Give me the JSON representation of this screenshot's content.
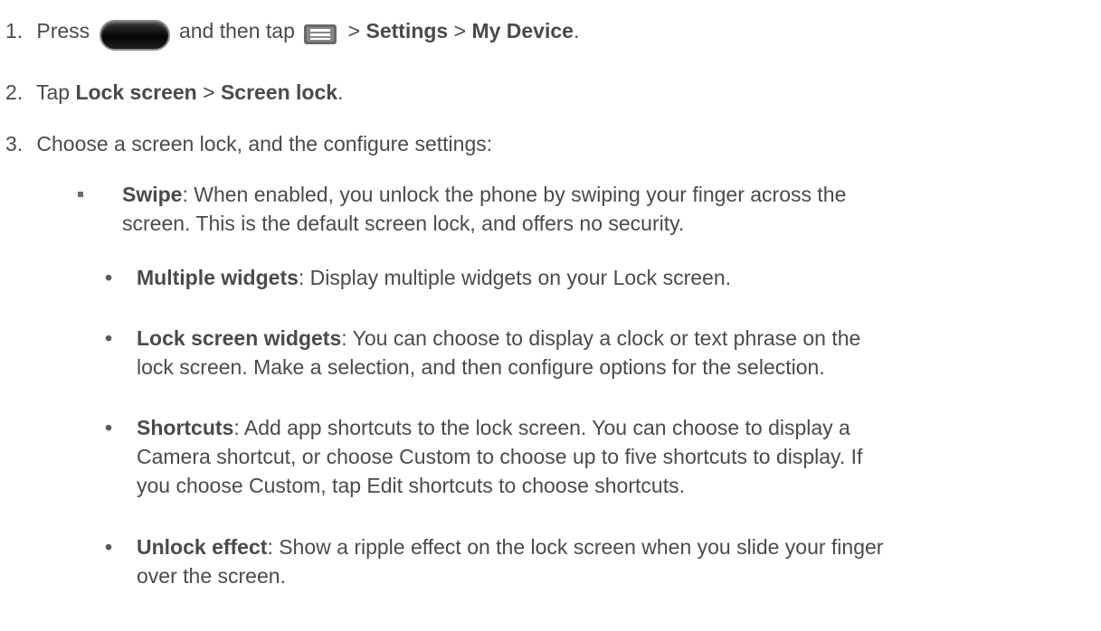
{
  "steps": [
    {
      "number": "1.",
      "t1": "Press",
      "t2": "and then tap",
      "t3": ">",
      "b1": "Settings",
      "t4": ">",
      "b2": "My Device",
      "t5": "."
    },
    {
      "number": "2.",
      "t1": "Tap",
      "b1": "Lock screen",
      "t2": ">",
      "b2": "Screen lock",
      "t3": "."
    },
    {
      "number": "3.",
      "text": "Choose a screen lock, and the configure settings:"
    }
  ],
  "swipe": {
    "term": "Swipe",
    "line1": ": When enabled, you unlock the phone by swiping your finger across the",
    "line2": "screen. This is the default screen lock, and offers no security."
  },
  "options": [
    {
      "term": "Multiple widgets",
      "lines": [
        ": Display multiple widgets on your Lock screen."
      ]
    },
    {
      "term": "Lock screen widgets",
      "lines": [
        ": You can choose to display a clock or text phrase on the",
        "lock screen. Make a selection, and then configure options for the selection."
      ]
    },
    {
      "term": "Shortcuts",
      "lines": [
        ": Add app shortcuts to the lock screen. You can choose to display a",
        "Camera shortcut, or choose Custom to choose up to five shortcuts to display. If",
        "you choose Custom, tap Edit shortcuts to choose shortcuts."
      ]
    },
    {
      "term": "Unlock effect",
      "lines": [
        ": Show a ripple effect on the lock screen when you slide your finger",
        "over the screen."
      ]
    }
  ],
  "icons": {
    "home_button": "home-button-icon",
    "menu": "menu-icon"
  }
}
